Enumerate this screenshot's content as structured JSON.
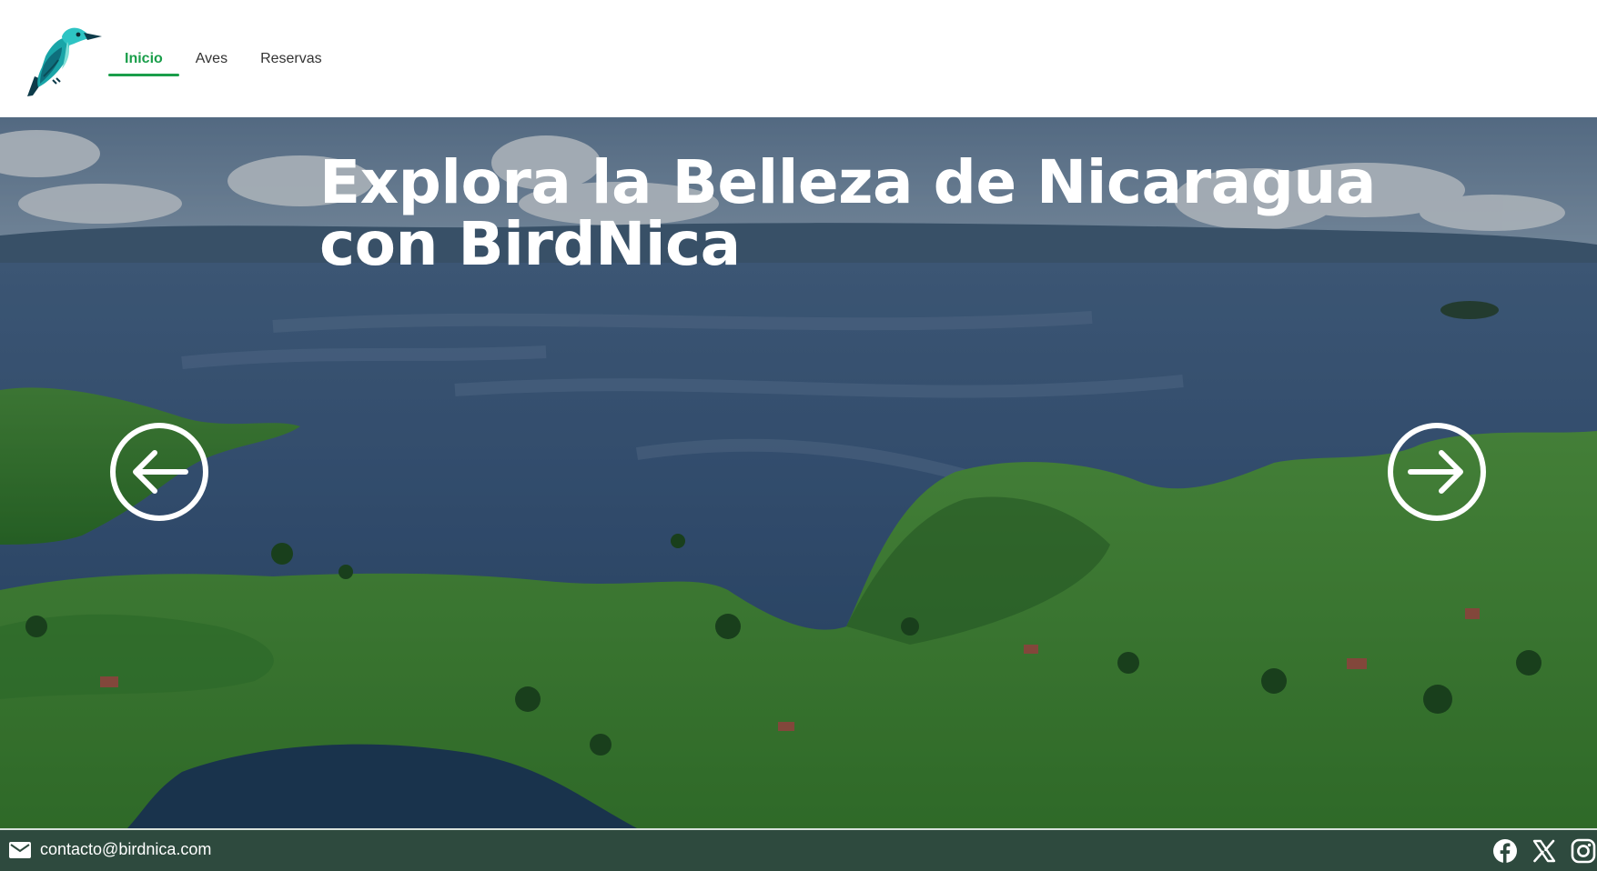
{
  "header": {
    "logo_icon": "kingfisher-bird-logo-icon",
    "nav": [
      {
        "label": "Inicio",
        "active": true
      },
      {
        "label": "Aves",
        "active": false
      },
      {
        "label": "Reservas",
        "active": false
      }
    ],
    "active_color": "#1a9e4a"
  },
  "hero": {
    "title_line1": "Explora la Belleza de Nicaragua",
    "title_line2": "con BirdNica",
    "prev_icon": "arrow-left-circle-icon",
    "next_icon": "arrow-right-circle-icon"
  },
  "footer": {
    "email_icon": "mail-icon",
    "email": "contacto@birdnica.com",
    "background": "#2e4a3e",
    "socials": [
      "facebook-icon",
      "x-icon",
      "instagram-icon"
    ]
  }
}
